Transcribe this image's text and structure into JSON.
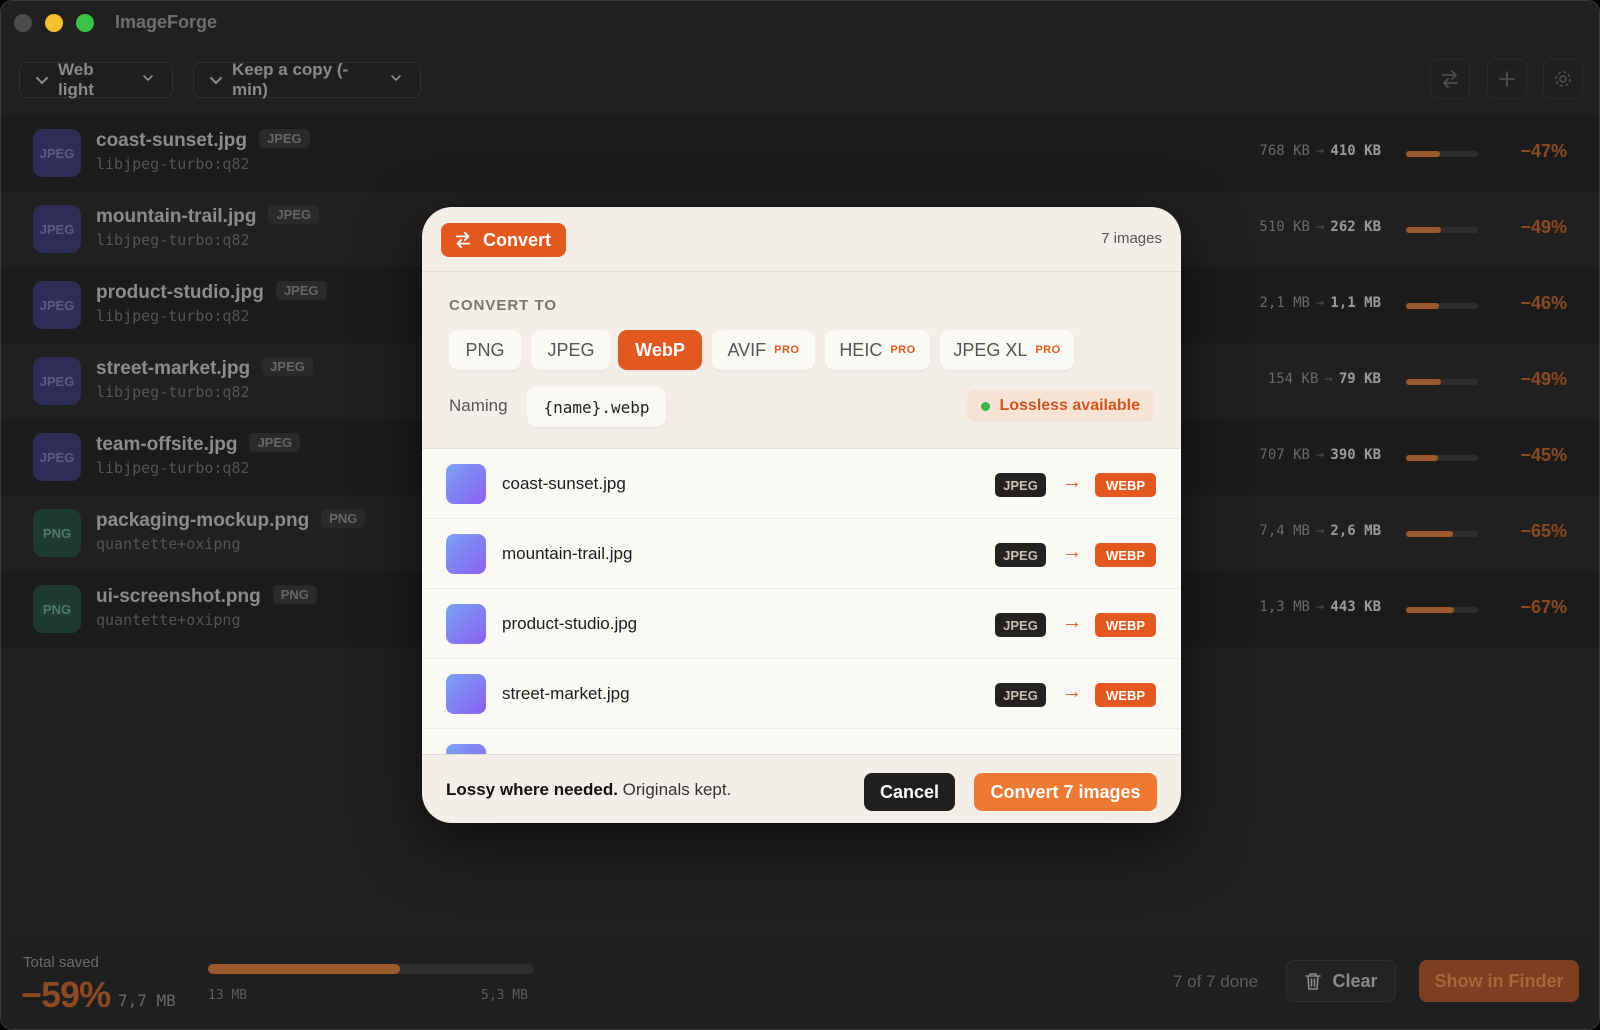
{
  "app": {
    "title": "ImageForge"
  },
  "toolbar": {
    "preset": "Web light",
    "copy_mode": "Keep a copy (-min)",
    "icons": [
      "swap-icon",
      "plus-icon",
      "gear-icon"
    ]
  },
  "files": [
    {
      "name": "coast-sunset.jpg",
      "tag": "JPEG",
      "thumb": "JPEG",
      "encoder": "libjpeg-turbo:q82",
      "before": "768 KB",
      "after": "410 KB",
      "saved_fraction": 0.47,
      "pct": "−47%"
    },
    {
      "name": "mountain-trail.jpg",
      "tag": "JPEG",
      "thumb": "JPEG",
      "encoder": "libjpeg-turbo:q82",
      "before": "510 KB",
      "after": "262 KB",
      "saved_fraction": 0.49,
      "pct": "−49%"
    },
    {
      "name": "product-studio.jpg",
      "tag": "JPEG",
      "thumb": "JPEG",
      "encoder": "libjpeg-turbo:q82",
      "before": "2,1 MB",
      "after": "1,1 MB",
      "saved_fraction": 0.46,
      "pct": "−46%"
    },
    {
      "name": "street-market.jpg",
      "tag": "JPEG",
      "thumb": "JPEG",
      "encoder": "libjpeg-turbo:q82",
      "before": "154 KB",
      "after": "79 KB",
      "saved_fraction": 0.49,
      "pct": "−49%"
    },
    {
      "name": "team-offsite.jpg",
      "tag": "JPEG",
      "thumb": "JPEG",
      "encoder": "libjpeg-turbo:q82",
      "before": "707 KB",
      "after": "390 KB",
      "saved_fraction": 0.45,
      "pct": "−45%"
    },
    {
      "name": "packaging-mockup.png",
      "tag": "PNG",
      "thumb": "PNG",
      "encoder": "quantette+oxipng",
      "before": "7,4 MB",
      "after": "2,6 MB",
      "saved_fraction": 0.65,
      "pct": "−65%"
    },
    {
      "name": "ui-screenshot.png",
      "tag": "PNG",
      "thumb": "PNG",
      "encoder": "quantette+oxipng",
      "before": "1,3 MB",
      "after": "443 KB",
      "saved_fraction": 0.67,
      "pct": "−67%"
    }
  ],
  "footer": {
    "total_label": "Total saved",
    "total_pct": "−59%",
    "total_size": "7,7 MB",
    "bar_start": "13 MB",
    "bar_end": "5,3 MB",
    "bar_fraction": 0.59,
    "done": "7 of 7 done",
    "clear": "Clear",
    "show_in_finder": "Show in Finder"
  },
  "modal": {
    "title": "Convert",
    "count": "7 images",
    "section": "CONVERT TO",
    "formats": [
      {
        "label": "PNG",
        "pro": ""
      },
      {
        "label": "JPEG",
        "pro": ""
      },
      {
        "label": "WebP",
        "pro": ""
      },
      {
        "label": "AVIF",
        "pro": "PRO"
      },
      {
        "label": "HEIC",
        "pro": "PRO"
      },
      {
        "label": "JPEG XL",
        "pro": "PRO"
      }
    ],
    "selected_format": "WebP",
    "naming_label": "Naming",
    "naming_value": "{name}.webp",
    "lossless": "Lossless available",
    "items": [
      {
        "name": "coast-sunset.jpg",
        "from": "JPEG",
        "to": "WEBP"
      },
      {
        "name": "mountain-trail.jpg",
        "from": "JPEG",
        "to": "WEBP"
      },
      {
        "name": "product-studio.jpg",
        "from": "JPEG",
        "to": "WEBP"
      },
      {
        "name": "street-market.jpg",
        "from": "JPEG",
        "to": "WEBP"
      }
    ],
    "footer_bold": "Lossy where needed.",
    "footer_rest": " Originals kept.",
    "cancel": "Cancel",
    "confirm": "Convert 7 images"
  },
  "colors": {
    "accent": "#e3581e",
    "confirm": "#f07a34"
  }
}
